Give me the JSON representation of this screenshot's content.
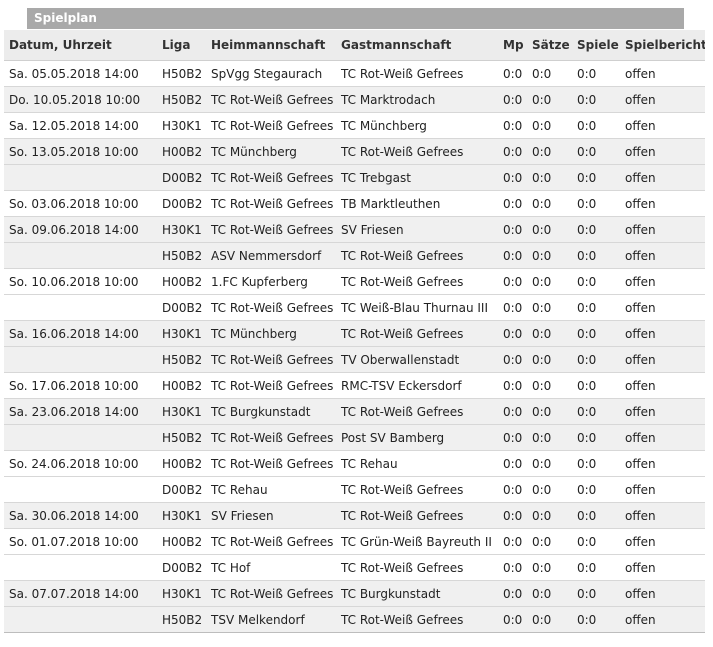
{
  "panel": {
    "title": "Spielplan"
  },
  "table": {
    "columns": [
      "Datum, Uhrzeit",
      "Liga",
      "Heimmannschaft",
      "Gastmannschaft",
      "Mp",
      "Sätze",
      "Spiele",
      "Spielbericht"
    ],
    "rows": [
      {
        "date": "Sa.  05.05.2018 14:00",
        "liga": "H50B2",
        "home": "SpVgg Stegaurach",
        "guest": "TC Rot-Weiß Gefrees",
        "mp": "0:0",
        "saetze": "0:0",
        "spiele": "0:0",
        "bericht": "offen"
      },
      {
        "date": "Do.  10.05.2018 10:00",
        "liga": "H50B2",
        "home": "TC Rot-Weiß Gefrees",
        "guest": "TC Marktrodach",
        "mp": "0:0",
        "saetze": "0:0",
        "spiele": "0:0",
        "bericht": "offen"
      },
      {
        "date": "Sa.  12.05.2018 14:00",
        "liga": "H30K1",
        "home": "TC Rot-Weiß Gefrees",
        "guest": "TC Münchberg",
        "mp": "0:0",
        "saetze": "0:0",
        "spiele": "0:0",
        "bericht": "offen"
      },
      {
        "date": "So.  13.05.2018 10:00",
        "liga": "H00B2",
        "home": "TC Münchberg",
        "guest": "TC Rot-Weiß Gefrees",
        "mp": "0:0",
        "saetze": "0:0",
        "spiele": "0:0",
        "bericht": "offen"
      },
      {
        "date": "",
        "liga": "D00B2",
        "home": "TC Rot-Weiß Gefrees",
        "guest": "TC Trebgast",
        "mp": "0:0",
        "saetze": "0:0",
        "spiele": "0:0",
        "bericht": "offen"
      },
      {
        "date": "So.  03.06.2018 10:00",
        "liga": "D00B2",
        "home": "TC Rot-Weiß Gefrees",
        "guest": "TB Marktleuthen",
        "mp": "0:0",
        "saetze": "0:0",
        "spiele": "0:0",
        "bericht": "offen"
      },
      {
        "date": "Sa.  09.06.2018 14:00",
        "liga": "H30K1",
        "home": "TC Rot-Weiß Gefrees",
        "guest": "SV Friesen",
        "mp": "0:0",
        "saetze": "0:0",
        "spiele": "0:0",
        "bericht": "offen"
      },
      {
        "date": "",
        "liga": "H50B2",
        "home": "ASV Nemmersdorf",
        "guest": "TC Rot-Weiß Gefrees",
        "mp": "0:0",
        "saetze": "0:0",
        "spiele": "0:0",
        "bericht": "offen"
      },
      {
        "date": "So.  10.06.2018 10:00",
        "liga": "H00B2",
        "home": "1.FC Kupferberg",
        "guest": "TC Rot-Weiß Gefrees",
        "mp": "0:0",
        "saetze": "0:0",
        "spiele": "0:0",
        "bericht": "offen"
      },
      {
        "date": "",
        "liga": "D00B2",
        "home": "TC Rot-Weiß Gefrees",
        "guest": "TC Weiß-Blau Thurnau III",
        "mp": "0:0",
        "saetze": "0:0",
        "spiele": "0:0",
        "bericht": "offen"
      },
      {
        "date": "Sa.  16.06.2018 14:00",
        "liga": "H30K1",
        "home": "TC Münchberg",
        "guest": "TC Rot-Weiß Gefrees",
        "mp": "0:0",
        "saetze": "0:0",
        "spiele": "0:0",
        "bericht": "offen"
      },
      {
        "date": "",
        "liga": "H50B2",
        "home": "TC Rot-Weiß Gefrees",
        "guest": "TV Oberwallenstadt",
        "mp": "0:0",
        "saetze": "0:0",
        "spiele": "0:0",
        "bericht": "offen"
      },
      {
        "date": "So.  17.06.2018 10:00",
        "liga": "H00B2",
        "home": "TC Rot-Weiß Gefrees",
        "guest": "RMC-TSV Eckersdorf",
        "mp": "0:0",
        "saetze": "0:0",
        "spiele": "0:0",
        "bericht": "offen"
      },
      {
        "date": "Sa.  23.06.2018 14:00",
        "liga": "H30K1",
        "home": "TC Burgkunstadt",
        "guest": "TC Rot-Weiß Gefrees",
        "mp": "0:0",
        "saetze": "0:0",
        "spiele": "0:0",
        "bericht": "offen"
      },
      {
        "date": "",
        "liga": "H50B2",
        "home": "TC Rot-Weiß Gefrees",
        "guest": "Post SV Bamberg",
        "mp": "0:0",
        "saetze": "0:0",
        "spiele": "0:0",
        "bericht": "offen"
      },
      {
        "date": "So.  24.06.2018 10:00",
        "liga": "H00B2",
        "home": "TC Rot-Weiß Gefrees",
        "guest": "TC Rehau",
        "mp": "0:0",
        "saetze": "0:0",
        "spiele": "0:0",
        "bericht": "offen"
      },
      {
        "date": "",
        "liga": "D00B2",
        "home": "TC Rehau",
        "guest": "TC Rot-Weiß Gefrees",
        "mp": "0:0",
        "saetze": "0:0",
        "spiele": "0:0",
        "bericht": "offen"
      },
      {
        "date": "Sa.  30.06.2018 14:00",
        "liga": "H30K1",
        "home": "SV Friesen",
        "guest": "TC Rot-Weiß Gefrees",
        "mp": "0:0",
        "saetze": "0:0",
        "spiele": "0:0",
        "bericht": "offen"
      },
      {
        "date": "So.  01.07.2018 10:00",
        "liga": "H00B2",
        "home": "TC Rot-Weiß Gefrees",
        "guest": "TC Grün-Weiß Bayreuth II",
        "mp": "0:0",
        "saetze": "0:0",
        "spiele": "0:0",
        "bericht": "offen"
      },
      {
        "date": "",
        "liga": "D00B2",
        "home": "TC Hof",
        "guest": "TC Rot-Weiß Gefrees",
        "mp": "0:0",
        "saetze": "0:0",
        "spiele": "0:0",
        "bericht": "offen"
      },
      {
        "date": "Sa.  07.07.2018 14:00",
        "liga": "H30K1",
        "home": "TC Rot-Weiß Gefrees",
        "guest": "TC Burgkunstadt",
        "mp": "0:0",
        "saetze": "0:0",
        "spiele": "0:0",
        "bericht": "offen"
      },
      {
        "date": "",
        "liga": "H50B2",
        "home": "TSV Melkendorf",
        "guest": "TC Rot-Weiß Gefrees",
        "mp": "0:0",
        "saetze": "0:0",
        "spiele": "0:0",
        "bericht": "offen"
      }
    ]
  }
}
